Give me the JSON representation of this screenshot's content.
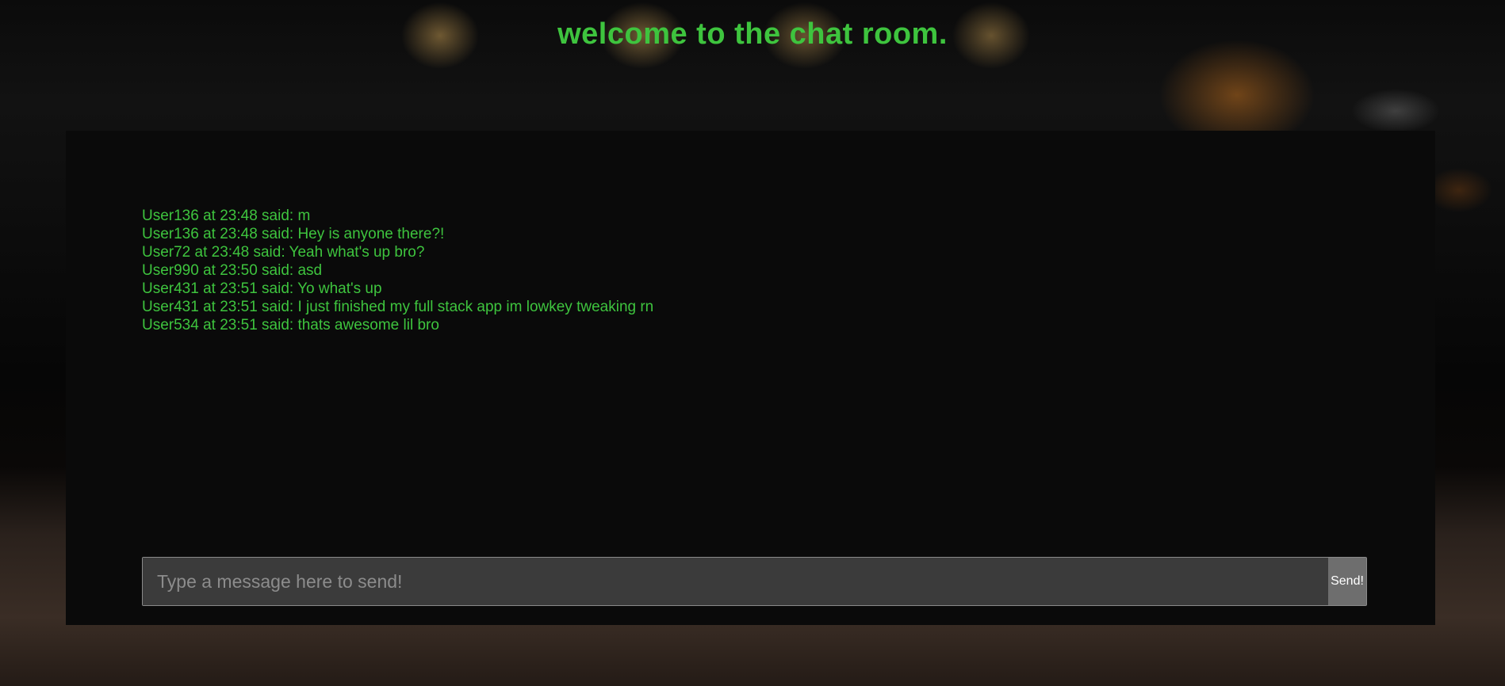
{
  "header": {
    "title": "welcome to the chat room."
  },
  "messages": [
    "User136 at 23:48 said: m",
    "User136 at 23:48 said: Hey is anyone there?!",
    "User72 at 23:48 said: Yeah what's up bro?",
    "User990 at 23:50 said: asd",
    "User431 at 23:51 said: Yo what's up",
    "User431 at 23:51 said: I just finished my full stack app im lowkey tweaking rn",
    "User534 at 23:51 said: thats awesome lil bro"
  ],
  "composer": {
    "placeholder": "Type a message here to send!",
    "value": "",
    "send_label": "Send!"
  },
  "colors": {
    "accent_text": "#3ec43e",
    "panel_background": "#0a0a0a",
    "input_background": "#3b3b3b",
    "send_button_background": "#6e6e6e"
  }
}
